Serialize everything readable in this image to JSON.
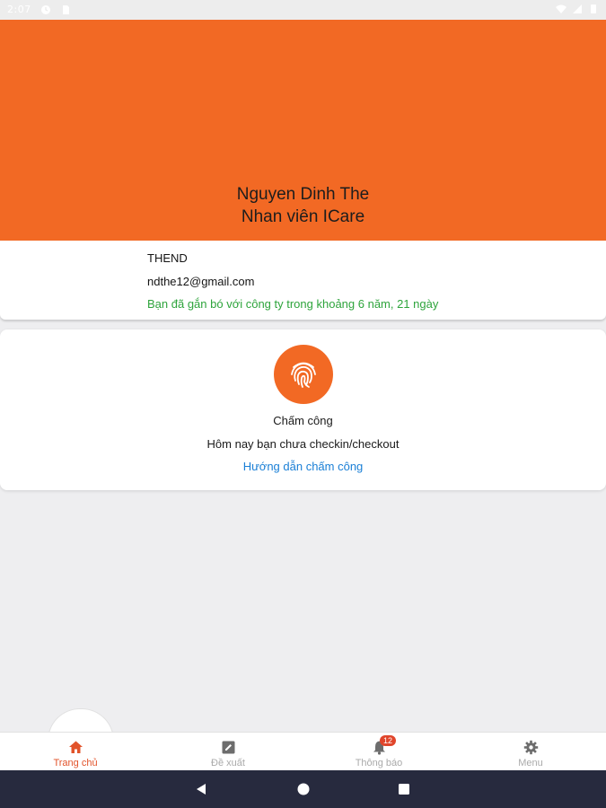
{
  "status_bar": {
    "time": "2:07"
  },
  "header": {
    "name": "Nguyen Dinh The",
    "role": "Nhan viên ICare",
    "color": "#f26924"
  },
  "info": {
    "username": "THEND",
    "email": "ndthe12@gmail.com",
    "tenure": "Bạn đã gắn bó với công ty trong khoảng 6 năm, 21 ngày",
    "tenure_color": "#2ea43c"
  },
  "attendance": {
    "icon": "fingerprint-icon",
    "title": "Chấm công",
    "status": "Hôm nay bạn chưa checkin/checkout",
    "guide_link": "Hướng dẫn chấm công",
    "link_color": "#1a7fd6"
  },
  "bottom_nav": {
    "items": [
      {
        "label": "Trang chủ",
        "icon": "home-icon",
        "active": true
      },
      {
        "label": "Đề xuất",
        "icon": "edit-note-icon",
        "active": false
      },
      {
        "label": "Thông báo",
        "icon": "bell-icon",
        "active": false,
        "badge": "12"
      },
      {
        "label": "Menu",
        "icon": "gear-icon",
        "active": false
      }
    ],
    "active_color": "#e2532a"
  },
  "system_nav": {
    "buttons": [
      "back-icon",
      "home-circle-icon",
      "recents-icon"
    ]
  }
}
